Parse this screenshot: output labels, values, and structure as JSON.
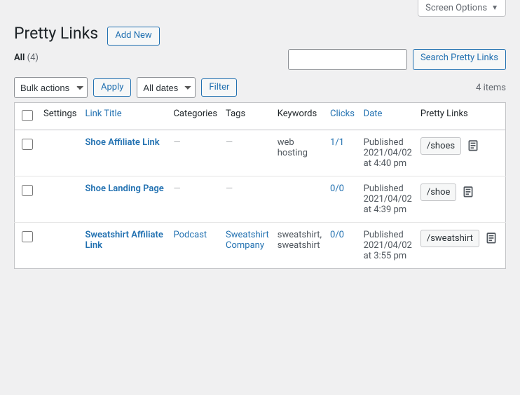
{
  "screenOptions": {
    "label": "Screen Options"
  },
  "header": {
    "title": "Pretty Links",
    "addNew": "Add New"
  },
  "filters": {
    "allLabel": "All",
    "allCount": "(4)"
  },
  "search": {
    "placeholder": "",
    "button": "Search Pretty Links"
  },
  "toolbar": {
    "bulkActionsLabel": "Bulk actions",
    "apply": "Apply",
    "allDatesLabel": "All dates",
    "filter": "Filter",
    "itemsCount": "4 items"
  },
  "columns": {
    "settings": "Settings",
    "linkTitle": "Link Title",
    "categories": "Categories",
    "tags": "Tags",
    "keywords": "Keywords",
    "clicks": "Clicks",
    "date": "Date",
    "prettyLinks": "Pretty Links"
  },
  "rows": [
    {
      "icons": [
        "star",
        "close"
      ],
      "title": "Shoe Affiliate Link",
      "categories": "—",
      "categoriesIsLink": false,
      "tags": "—",
      "tagsIsLink": false,
      "keywords": "web hosting",
      "clicks": "1/1",
      "date": "Published 2021/04/02 at 4:40 pm",
      "slug": "/shoes"
    },
    {
      "icons": [
        "forward",
        "close",
        "shuffle"
      ],
      "title": "Shoe Landing Page",
      "categories": "—",
      "categoriesIsLink": false,
      "tags": "—",
      "tagsIsLink": false,
      "keywords": "",
      "clicks": "0/0",
      "date": "Published 2021/04/02 at 4:39 pm",
      "slug": "/shoe"
    },
    {
      "icons": [
        "forward",
        "close"
      ],
      "title": "Sweatshirt Affiliate Link",
      "categories": "Podcast",
      "categoriesIsLink": true,
      "tags": "Sweatshirt Company",
      "tagsIsLink": true,
      "keywords": "sweatshirt, sweatshirt",
      "clicks": "0/0",
      "date": "Published 2021/04/02 at 3:55 pm",
      "slug": "/sweatshirt"
    }
  ]
}
